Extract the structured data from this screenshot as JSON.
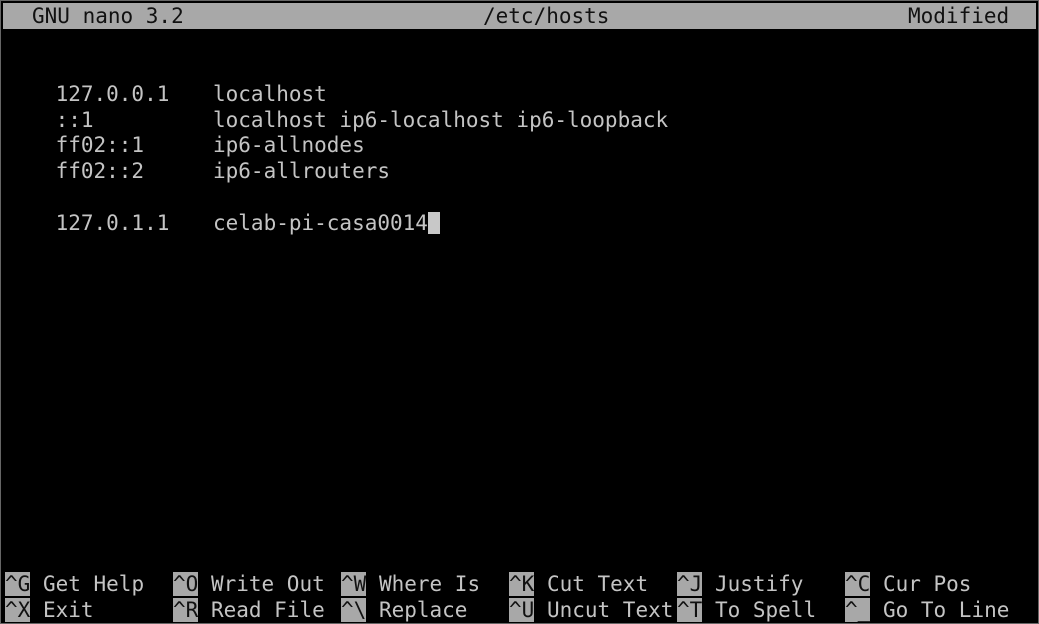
{
  "titlebar": {
    "app": "GNU nano 3.2",
    "file": "/etc/hosts",
    "status": "Modified"
  },
  "file_lines": [
    {
      "ip": "127.0.0.1",
      "host": "localhost"
    },
    {
      "ip": "::1",
      "host": "localhost ip6-localhost ip6-loopback"
    },
    {
      "ip": "ff02::1",
      "host": "ip6-allnodes"
    },
    {
      "ip": "ff02::2",
      "host": "ip6-allrouters"
    },
    {
      "ip": "",
      "host": ""
    },
    {
      "ip": "127.0.1.1",
      "host": "celab-pi-casa0014"
    }
  ],
  "shortcuts": [
    {
      "key": "^G",
      "label": "Get Help"
    },
    {
      "key": "^O",
      "label": "Write Out"
    },
    {
      "key": "^W",
      "label": "Where Is"
    },
    {
      "key": "^K",
      "label": "Cut Text"
    },
    {
      "key": "^J",
      "label": "Justify"
    },
    {
      "key": "^C",
      "label": "Cur Pos"
    },
    {
      "key": "^X",
      "label": "Exit"
    },
    {
      "key": "^R",
      "label": "Read File"
    },
    {
      "key": "^\\",
      "label": "Replace"
    },
    {
      "key": "^U",
      "label": "Uncut Text"
    },
    {
      "key": "^T",
      "label": "To Spell"
    },
    {
      "key": "^_",
      "label": "Go To Line"
    }
  ]
}
